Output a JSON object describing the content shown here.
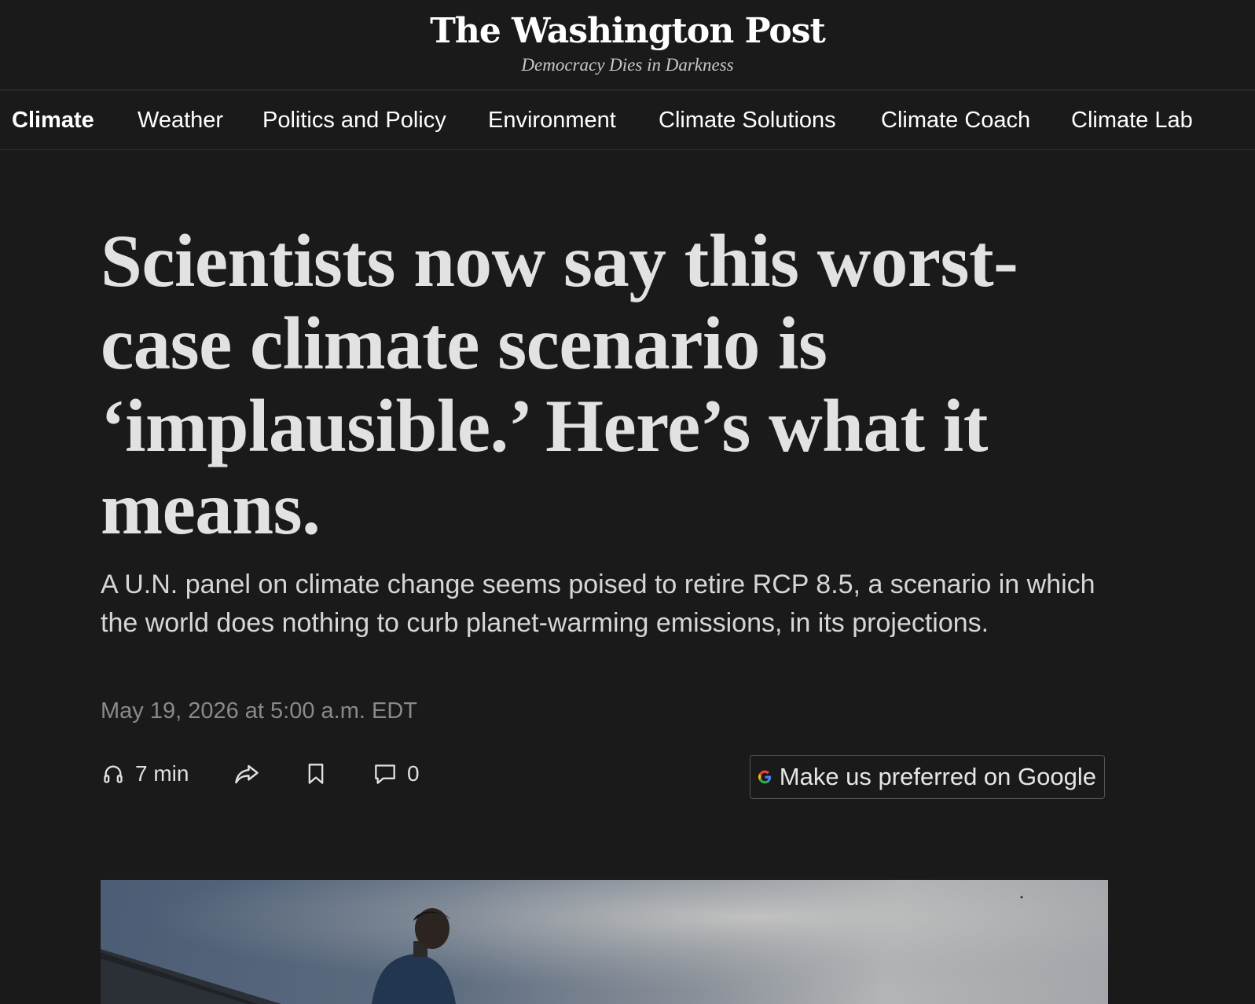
{
  "masthead": {
    "logo": "The Washington Post",
    "tagline": "Democracy Dies in Darkness"
  },
  "nav": {
    "items": [
      {
        "label": "Climate",
        "active": true
      },
      {
        "label": "Weather"
      },
      {
        "label": "Politics and Policy"
      },
      {
        "label": "Environment"
      },
      {
        "label": "Climate Solutions"
      },
      {
        "label": "Climate Coach"
      },
      {
        "label": "Climate Lab"
      }
    ]
  },
  "article": {
    "headline": "Scientists now say this worst-case climate scenario is ‘implausible.’ Here’s what it means.",
    "dek": "A U.N. panel on climate change seems poised to retire RCP 8.5, a scenario in which the world does nothing to curb planet-warming emissions, in its projections.",
    "dateline": "May 19, 2026 at 5:00 a.m. EDT"
  },
  "toolbar": {
    "listen_label": "7 min",
    "comment_count": "0",
    "google_button_label": "Make us preferred on Google"
  },
  "icons": {
    "listen": "headphones-icon",
    "share": "share-icon",
    "save": "bookmark-icon",
    "comments": "comment-icon",
    "google": "google-g-icon"
  }
}
